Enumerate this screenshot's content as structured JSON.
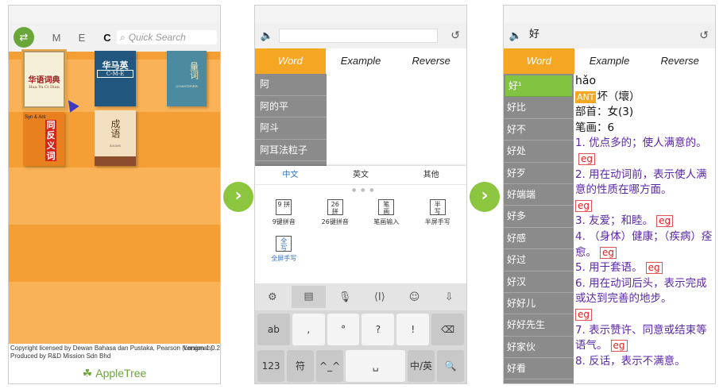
{
  "screen1": {
    "tabs": [
      "M",
      "E",
      "C"
    ],
    "search_placeholder": "Quick Search",
    "books": [
      {
        "title": "华语词典",
        "subtitle": "Hua Yu Ci Dian"
      },
      {
        "title": "华马英",
        "subtitle": "C-M-E"
      },
      {
        "title": "量词",
        "subtitle": "QUANTIFIER"
      },
      {
        "title": "同反义词",
        "subtitle": "Syn & Ant"
      },
      {
        "title": "成语",
        "subtitle": "IDIOMS"
      }
    ],
    "copyright": "Copyright licensed by Dewan Bahasa dan Pustaka, Pearson (Longman). Produced by R&D Mission Sdn Bhd",
    "version": "Version 1.0.2",
    "brand": "AppleTree"
  },
  "screen2": {
    "tabs": [
      "Word",
      "Example",
      "Reverse"
    ],
    "list": [
      "阿",
      "阿的平",
      "阿斗",
      "阿耳法粒子"
    ],
    "ime_tabs": [
      "中文",
      "英文",
      "其他"
    ],
    "ime_options": [
      {
        "box": "9 拼",
        "label": "9键拼音"
      },
      {
        "box": "26 拼",
        "label": "26键拼音"
      },
      {
        "box": "笔 画",
        "label": "笔画输入"
      },
      {
        "box": "半 写",
        "label": "半屏手写"
      },
      {
        "box": "全 写",
        "label": "全屏手写"
      }
    ],
    "keys_row1": [
      "ab",
      ",",
      "°",
      "?",
      "!",
      "⌫"
    ],
    "keys_row2": [
      "123",
      "符",
      "^_^",
      "␣",
      "中/英",
      "🔍"
    ]
  },
  "screen3": {
    "search_value": "好",
    "tabs": [
      "Word",
      "Example",
      "Reverse"
    ],
    "list": [
      "好¹",
      "好比",
      "好不",
      "好处",
      "好歹",
      "好端端",
      "好多",
      "好感",
      "好过",
      "好汉",
      "好好儿",
      "好好先生",
      "好家伙",
      "好看"
    ],
    "pinyin": "hǎo",
    "ant_label": "ANT",
    "antonym": "坏（壞）",
    "radical": "部首：女(3)",
    "strokes": "笔画：6",
    "senses": [
      "1. 优点多的；使人满意的。",
      "2. 用在动词前，表示使人满意的性质在哪方面。",
      "3. 友爱；和睦。",
      "4. （身体）健康；（疾病）痊愈。",
      "5. 用于套语。",
      "6. 用在动词后头，表示完成或达到完善的地步。",
      "7. 表示赞许、同意或结束等语气。",
      "8. 反话，表示不满意。"
    ],
    "eg_label": "eg"
  },
  "colors": {
    "orange": "#f5a623",
    "green": "#82c341",
    "purple": "#5b27a8",
    "gray_list": "#8b8b8b"
  }
}
